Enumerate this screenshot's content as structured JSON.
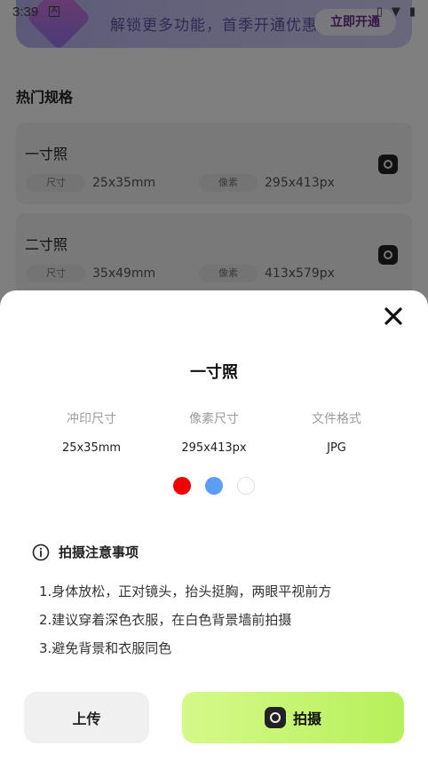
{
  "status_bar": {
    "time": "3:39",
    "a_icon": "A"
  },
  "banner": {
    "text": "解锁更多功能，首季开通优惠多多",
    "button": "立即开通"
  },
  "section": {
    "title": "热门规格"
  },
  "specs": [
    {
      "name": "一寸照",
      "size_tag": "尺寸",
      "size": "25x35mm",
      "pixel_tag": "像素",
      "pixels": "295x413px"
    },
    {
      "name": "二寸照",
      "size_tag": "尺寸",
      "size": "35x49mm",
      "pixel_tag": "像素",
      "pixels": "413x579px"
    }
  ],
  "sheet": {
    "title": "一寸照",
    "info": [
      {
        "label": "冲印尺寸",
        "value": "25x35mm"
      },
      {
        "label": "像素尺寸",
        "value": "295x413px"
      },
      {
        "label": "文件格式",
        "value": "JPG"
      }
    ],
    "colors": [
      {
        "name": "red",
        "hex": "#f00000"
      },
      {
        "name": "blue",
        "hex": "#5b9ef5"
      },
      {
        "name": "white",
        "hex": "#ffffff"
      }
    ],
    "notes_title": "拍摄注意事项",
    "notes": [
      "1.身体放松，正对镜头，抬头挺胸，两眼平视前方",
      "2.建议穿着深色衣服，在白色背景墙前拍摄",
      "3.避免背景和衣服同色"
    ],
    "buttons": {
      "upload": "上传",
      "shoot": "拍摄"
    }
  }
}
